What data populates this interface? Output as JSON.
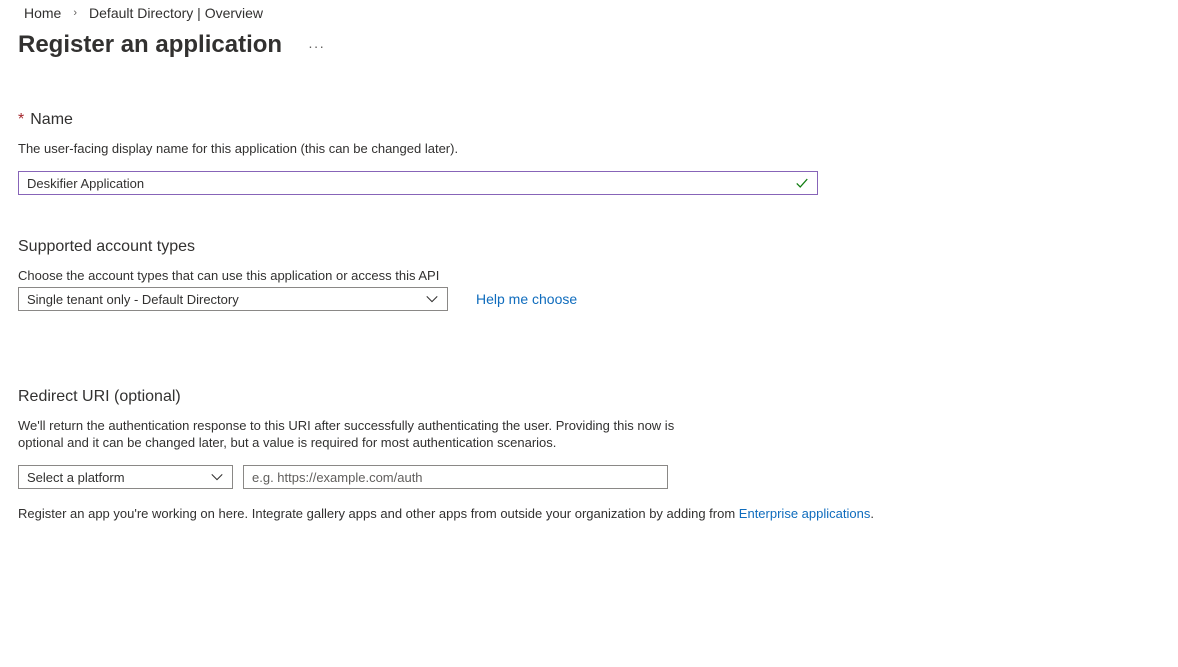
{
  "breadcrumb": {
    "home": "Home",
    "separator": "›",
    "current": "Default Directory | Overview"
  },
  "header": {
    "title": "Register an application",
    "more": "···"
  },
  "name_section": {
    "required_marker": "*",
    "label": "Name",
    "description": "The user-facing display name for this application (this can be changed later).",
    "value": "Deskifier Application",
    "valid_icon": "check-icon"
  },
  "account_types": {
    "heading": "Supported account types",
    "description": "Choose the account types that can use this application or access this API",
    "selected": "Single tenant only - Default Directory",
    "help_link": "Help me choose"
  },
  "redirect": {
    "heading": "Redirect URI (optional)",
    "description_line1": "We'll return the authentication response to this URI after successfully authenticating the user. Providing this now is",
    "description_line2": "optional and it can be changed later, but a value is required for most authentication scenarios.",
    "platform_placeholder": "Select a platform",
    "uri_placeholder": "e.g. https://example.com/auth"
  },
  "footer": {
    "text": "Register an app you're working on here. Integrate gallery apps and other apps from outside your organization by adding from ",
    "link": "Enterprise applications",
    "suffix": "."
  },
  "colors": {
    "accent_border": "#8764b8",
    "link": "#0f6cbd",
    "required": "#a4262c",
    "valid_check": "#107c10"
  }
}
